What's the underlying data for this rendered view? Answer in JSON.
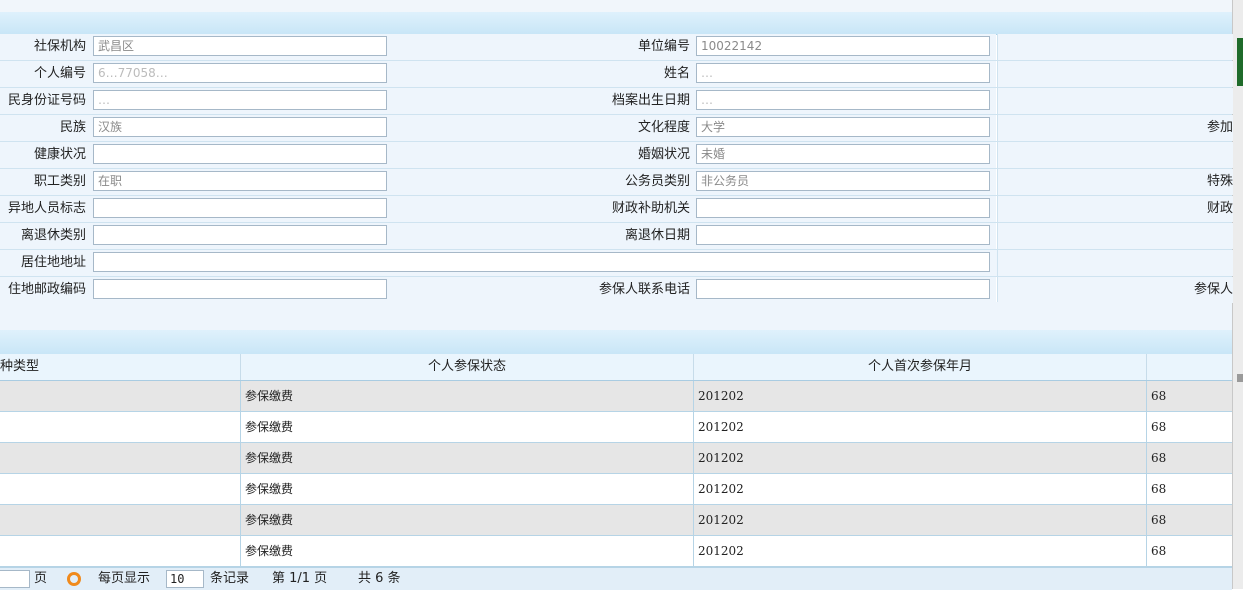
{
  "form": {
    "rows": [
      {
        "l1": "社保机构",
        "v1": "武昌区",
        "b1": false,
        "l2": "单位编号",
        "v2": "10022142",
        "b2": false,
        "l3": ""
      },
      {
        "l1": "个人编号",
        "v1": "6…77058…",
        "b1": true,
        "l2": "姓名",
        "v2": "…",
        "b2": true,
        "l3": ""
      },
      {
        "l1": "民身份证号码",
        "v1": "…",
        "b1": true,
        "l2": "档案出生日期",
        "v2": "…",
        "b2": true,
        "l3": ""
      },
      {
        "l1": "民族",
        "v1": "汉族",
        "b1": false,
        "l2": "文化程度",
        "v2": "大学",
        "b2": false,
        "l3": "参加"
      },
      {
        "l1": "健康状况",
        "v1": "",
        "b1": false,
        "l2": "婚姻状况",
        "v2": "未婚",
        "b2": false,
        "l3": ""
      },
      {
        "l1": "职工类别",
        "v1": "在职",
        "b1": false,
        "l2": "公务员类别",
        "v2": "非公务员",
        "b2": false,
        "l3": "特殊"
      },
      {
        "l1": "异地人员标志",
        "v1": "",
        "b1": false,
        "l2": "财政补助机关",
        "v2": "",
        "b2": false,
        "l3": "财政"
      },
      {
        "l1": "离退休类别",
        "v1": "",
        "b1": false,
        "l2": "离退休日期",
        "v2": "",
        "b2": false,
        "l3": ""
      },
      {
        "l1": "居住地地址",
        "v1": "",
        "b1": false,
        "wide": true,
        "l3": ""
      },
      {
        "l1": "住地邮政编码",
        "v1": "",
        "b1": false,
        "l2": "参保人联系电话",
        "v2": "",
        "b2": false,
        "l3": "参保人"
      }
    ]
  },
  "grid": {
    "headers": [
      "种类型",
      "个人参保状态",
      "个人首次参保年月",
      ""
    ],
    "rows": [
      {
        "type": "",
        "status": "参保缴费",
        "first": "201202",
        "extra": "68"
      },
      {
        "type": "",
        "status": "参保缴费",
        "first": "201202",
        "extra": "68"
      },
      {
        "type": "",
        "status": "参保缴费",
        "first": "201202",
        "extra": "68"
      },
      {
        "type": "",
        "status": "参保缴费",
        "first": "201202",
        "extra": "68"
      },
      {
        "type": "",
        "status": "参保缴费",
        "first": "201202",
        "extra": "68"
      },
      {
        "type": "",
        "status": "参保缴费",
        "first": "201202",
        "extra": "68"
      }
    ]
  },
  "pager": {
    "page_label": "页",
    "per_page_label": "每页显示",
    "per_page_value": "10",
    "records_label": "条记录",
    "page_info": "第 1/1 页",
    "total_info": "共  6  条",
    "refresh_icon": "refresh-icon"
  },
  "colors": {
    "header_bar": "#c9e6f7",
    "row_alt": "#e6e6e6",
    "label_bg": "#eef5fc",
    "refresh": "#f08a1c"
  }
}
